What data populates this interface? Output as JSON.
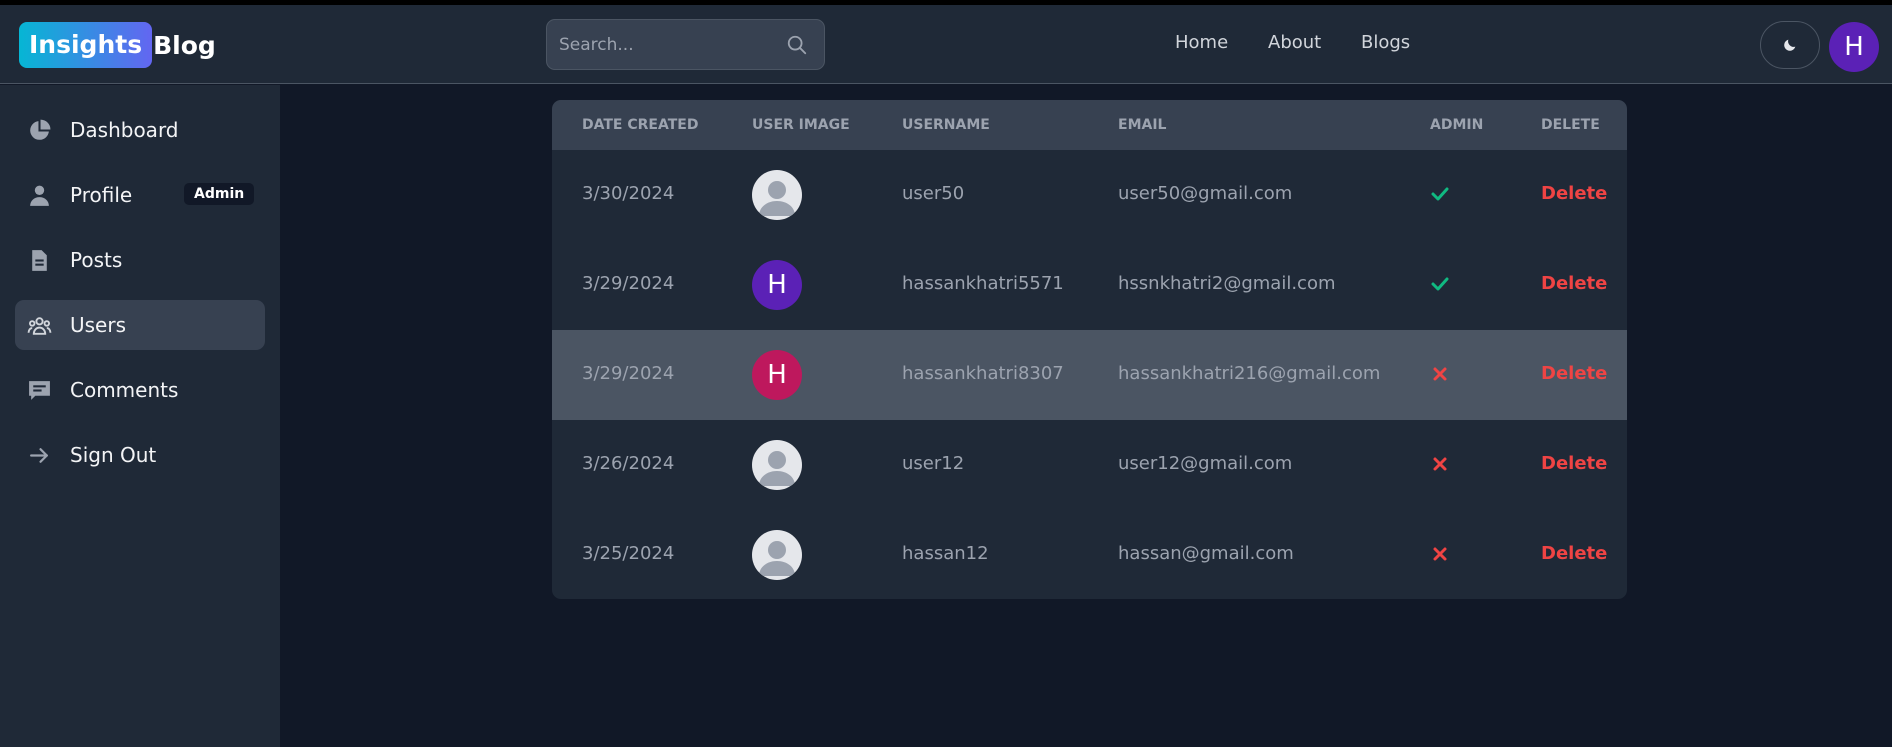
{
  "header": {
    "logo_highlight": "Insights",
    "logo_text": "Blog",
    "search_placeholder": "Search...",
    "nav": [
      "Home",
      "About",
      "Blogs"
    ],
    "avatar_letter": "H",
    "avatar_color": "#5b21b6",
    "theme_icon": "moon-icon"
  },
  "sidebar": {
    "items": [
      {
        "label": "Dashboard",
        "icon": "pie-chart-icon"
      },
      {
        "label": "Profile",
        "icon": "user-icon",
        "badge": "Admin"
      },
      {
        "label": "Posts",
        "icon": "document-icon"
      },
      {
        "label": "Users",
        "icon": "users-icon",
        "active": true
      },
      {
        "label": "Comments",
        "icon": "comment-icon"
      },
      {
        "label": "Sign Out",
        "icon": "arrow-right-icon"
      }
    ]
  },
  "table": {
    "columns": [
      "DATE CREATED",
      "USER IMAGE",
      "USERNAME",
      "EMAIL",
      "ADMIN",
      "DELETE"
    ],
    "rows": [
      {
        "date": "3/30/2024",
        "image": "default",
        "username": "user50",
        "email": "user50@gmail.com",
        "admin": true,
        "delete": "Delete"
      },
      {
        "date": "3/29/2024",
        "image": "H",
        "image_color": "#5b21b6",
        "username": "hassankhatri5571",
        "email": "hssnkhatri2@gmail.com",
        "admin": true,
        "delete": "Delete"
      },
      {
        "date": "3/29/2024",
        "image": "H",
        "image_color": "#be185d",
        "username": "hassankhatri8307",
        "email": "hassankhatri216@gmail.com",
        "admin": false,
        "delete": "Delete",
        "highlighted": true
      },
      {
        "date": "3/26/2024",
        "image": "default",
        "username": "user12",
        "email": "user12@gmail.com",
        "admin": false,
        "delete": "Delete"
      },
      {
        "date": "3/25/2024",
        "image": "default",
        "username": "hassan12",
        "email": "hassan@gmail.com",
        "admin": false,
        "delete": "Delete"
      }
    ]
  },
  "colors": {
    "admin_yes": "#10b981",
    "admin_no": "#ef4444",
    "delete": "#ef4444"
  }
}
